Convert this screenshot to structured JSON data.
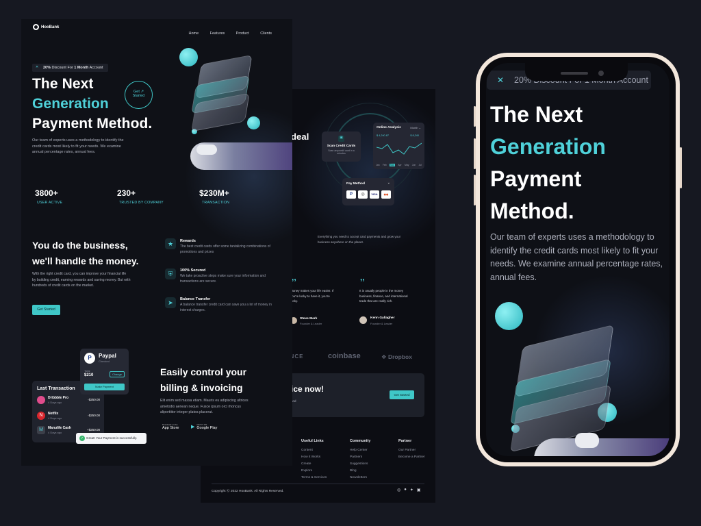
{
  "brand": "HooBank",
  "nav": [
    "Home",
    "Features",
    "Product",
    "Clients"
  ],
  "hero": {
    "pill_bold": "20%",
    "pill_text": "Discount For",
    "pill_bold2": "1 Month",
    "pill_text2": "Account",
    "line1": "The Next",
    "line2": "Generation",
    "line3": "Payment Method.",
    "desc": "Our team of experts uses a methodology to identify the credit cards most likely to fit your needs. We examine annual percentage rates, annual fees.",
    "cta_line1": "Get ↗",
    "cta_line2": "Started"
  },
  "stats": [
    {
      "num": "3800+",
      "label": "USER ACTIVE"
    },
    {
      "num": "230+",
      "label": "TRUSTED BY COMPANY"
    },
    {
      "num": "$230M+",
      "label": "TRANSACTION"
    }
  ],
  "business": {
    "line1": "You do the business,",
    "line2": "we'll handle the money.",
    "desc": "With the right credit card, you can improve your financial life by building credit, earning rewards and saving money. But with hundreds of credit cards on the market.",
    "button": "Get Started"
  },
  "features": [
    {
      "title": "Rewards",
      "text": "The best credit cards offer some tantalizing combinations of promotions and prizes",
      "icon": "star-icon"
    },
    {
      "title": "100% Secured",
      "text": "We take proactive steps make sure your information and transactions are secure.",
      "icon": "shield-icon"
    },
    {
      "title": "Balance Transfer",
      "text": "A balance transfer credit card can save you a lot of money in interest charges.",
      "icon": "send-icon"
    }
  ],
  "paypal": {
    "name": "Paypal",
    "status": "Checked",
    "total_label": "Total",
    "total": "$210",
    "change": "Change",
    "make_payment": "Make Payment"
  },
  "last_transaction": {
    "title": "Last Transaction",
    "items": [
      {
        "name": "Dribbble Pro",
        "time": "4 Days ago",
        "amount": "-$250.00",
        "color": "#e04c8c"
      },
      {
        "name": "Netflix",
        "time": "4 Days ago",
        "amount": "-$250.00",
        "color": "#d8262d"
      },
      {
        "name": "Manulife Cash",
        "time": "4 Days ago",
        "amount": "+$250.00",
        "color": "#3c3f49"
      }
    ],
    "toast": "Great! Your Payment is successfully."
  },
  "billing": {
    "line1": "Easily control your",
    "line2": "billing & invoicing",
    "desc": "Elit enim sed massa etiam. Mauris eu adipiscing ultrices ametodio aenean neque. Fusce ipsum orci rhoncus aliporttitor integer platea placerat.",
    "appstore_small": "Download on the",
    "appstore": "App Store",
    "gplay_small": "GET IT ON",
    "gplay": "Google Play"
  },
  "back": {
    "deal_word": "deal",
    "scan_title": "Scan Credit Cards",
    "scan_text": "Scan anycredit card in a minutes",
    "analysis_title": "Online Analysis",
    "analysis_period": "Month",
    "analysis_v1": "$ 4,240.87",
    "analysis_v2": "$ 8,240",
    "analysis_months": [
      "Jan",
      "Feb",
      "Mar",
      "Apr",
      "May",
      "Jun",
      "Jul"
    ],
    "pay_method": "Pay Method",
    "pay_logos": [
      "P",
      "◎",
      "VISA",
      "⬤⬤"
    ],
    "accept_text": "Everything you need to accept card payments and grow your business anywhere on the planet.",
    "testimonials": [
      {
        "text": "Money makes your life easier. If you're lucky to have it, you're lucky.",
        "name": "Steve Mark",
        "role": "Founder & Leader"
      },
      {
        "text": "It is usually people in the money business, finance, and international trade that are really rich.",
        "name": "Kenn Gallagher",
        "role": "Founder & Leader"
      }
    ],
    "partners": [
      "BINANCE",
      "coinbase",
      "Dropbox"
    ],
    "cta_title": "ice now!",
    "cta_text": "and",
    "cta_button": "Get Started",
    "footer_cols": [
      {
        "title": "Useful Links",
        "links": [
          "Content",
          "How it Works",
          "Create",
          "Explore",
          "Terms & Services"
        ]
      },
      {
        "title": "Community",
        "links": [
          "Help Center",
          "Partners",
          "Suggestions",
          "Blog",
          "Newsletters"
        ]
      },
      {
        "title": "Partner",
        "links": [
          "Our Partner",
          "Become a Partner"
        ]
      }
    ],
    "copyright": "Copyright Ⓒ 2022 HooBank. All Rights Reserved."
  },
  "phone": {
    "pill": "20% Discount For 1 Month Account",
    "line1": "The Next",
    "line2": "Generation",
    "line3": "Payment",
    "line4": "Method.",
    "desc": "Our team of experts uses a methodology to identify the credit cards most likely to fit your needs. We examine annual percentage rates, annual fees."
  }
}
